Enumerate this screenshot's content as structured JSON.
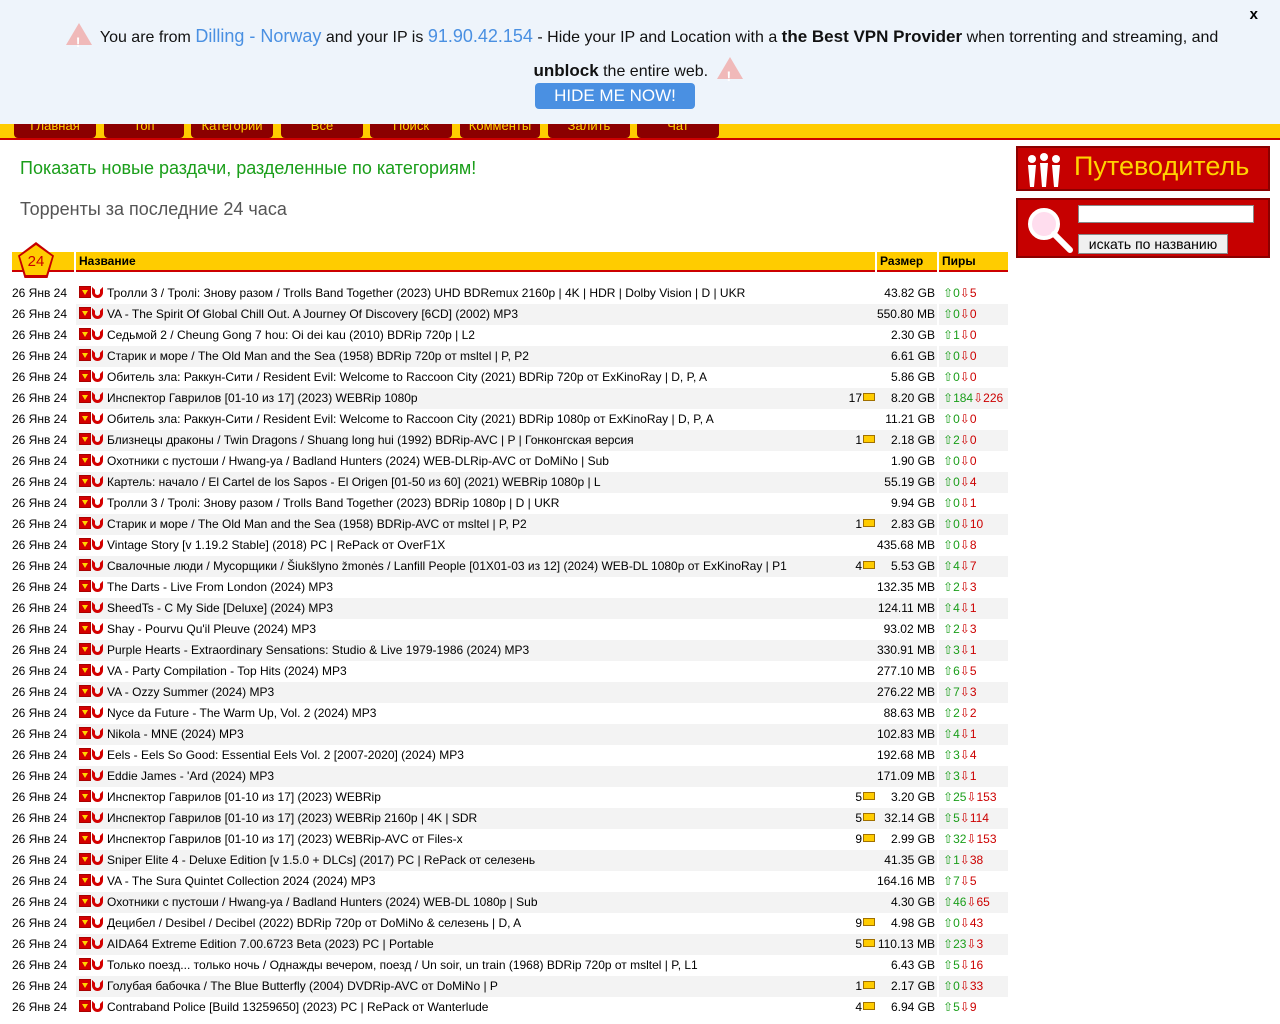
{
  "banner": {
    "close": "x",
    "t1": "You are from",
    "location": "Dilling - Norway",
    "t2": "and your IP is",
    "ip": "91.90.42.154",
    "t3": "- Hide your IP and Location with a",
    "best_vpn": "the Best VPN Provider",
    "t4": "when torrenting and streaming, and",
    "unblock": "unblock",
    "t5": "the entire web.",
    "button": "HIDE ME NOW!"
  },
  "nav": [
    "Главная",
    "Топ",
    "Категории",
    "Все",
    "Поиск",
    "Комменты",
    "Залить",
    "Чат"
  ],
  "promo": "Показать новые раздачи, разделенные по категориям!",
  "heading": "Торренты за последние 24 часа",
  "table": {
    "badge": "24",
    "col_name": "Название",
    "col_size": "Размер",
    "col_peers": "Пиры",
    "rows": [
      {
        "date": "26 Янв 24",
        "title": "Тролли 3 / Тролі: Знову разом / Trolls Band Together (2023) UHD BDRemux 2160p | 4K | HDR | Dolby Vision | D | UKR",
        "comments": "",
        "size": "43.82 GB",
        "seeds": "0",
        "leech": "5"
      },
      {
        "date": "26 Янв 24",
        "title": "VA - The Spirit Of Global Chill Out. A Journey Of Discovery [6CD] (2002) MP3",
        "comments": "",
        "size": "550.80 MB",
        "seeds": "0",
        "leech": "0"
      },
      {
        "date": "26 Янв 24",
        "title": "Седьмой 2 / Cheung Gong 7 hou: Oi dei kau (2010) BDRip 720p | L2",
        "comments": "",
        "size": "2.30 GB",
        "seeds": "1",
        "leech": "0"
      },
      {
        "date": "26 Янв 24",
        "title": "Старик и море / The Old Man and the Sea (1958) BDRip 720p от msltel | P, P2",
        "comments": "",
        "size": "6.61 GB",
        "seeds": "0",
        "leech": "0"
      },
      {
        "date": "26 Янв 24",
        "title": "Обитель зла: Раккун-Сити / Resident Evil: Welcome to Raccoon City (2021) BDRip 720p от ExKinoRay | D, P, A",
        "comments": "",
        "size": "5.86 GB",
        "seeds": "0",
        "leech": "0"
      },
      {
        "date": "26 Янв 24",
        "title": "Инспектор Гаврилов [01-10 из 17] (2023) WEBRip 1080p",
        "comments": "17",
        "size": "8.20 GB",
        "seeds": "184",
        "leech": "226"
      },
      {
        "date": "26 Янв 24",
        "title": "Обитель зла: Раккун-Сити / Resident Evil: Welcome to Raccoon City (2021) BDRip 1080p от ExKinoRay | D, P, A",
        "comments": "",
        "size": "11.21 GB",
        "seeds": "0",
        "leech": "0"
      },
      {
        "date": "26 Янв 24",
        "title": "Близнецы драконы / Twin Dragons / Shuang long hui (1992) BDRip-AVC | P | Гонконгская версия",
        "comments": "1",
        "size": "2.18 GB",
        "seeds": "2",
        "leech": "0"
      },
      {
        "date": "26 Янв 24",
        "title": "Охотники с пустоши / Hwang-ya / Badland Hunters (2024) WEB-DLRip-AVC от DoMiNo | Sub",
        "comments": "",
        "size": "1.90 GB",
        "seeds": "0",
        "leech": "0"
      },
      {
        "date": "26 Янв 24",
        "title": "Картель: начало / El Cartel de los Sapos - El Origen [01-50 из 60] (2021) WEBRip 1080p | L",
        "comments": "",
        "size": "55.19 GB",
        "seeds": "0",
        "leech": "4"
      },
      {
        "date": "26 Янв 24",
        "title": "Тролли 3 / Тролі: Знову разом / Trolls Band Together (2023) BDRip 1080p | D | UKR",
        "comments": "",
        "size": "9.94 GB",
        "seeds": "0",
        "leech": "1"
      },
      {
        "date": "26 Янв 24",
        "title": "Старик и море / The Old Man and the Sea (1958) BDRip-AVC от msltel | P, P2",
        "comments": "1",
        "size": "2.83 GB",
        "seeds": "0",
        "leech": "10"
      },
      {
        "date": "26 Янв 24",
        "title": "Vintage Story [v 1.19.2 Stable] (2018) PC | RePack от OverF1X",
        "comments": "",
        "size": "435.68 MB",
        "seeds": "0",
        "leech": "8"
      },
      {
        "date": "26 Янв 24",
        "title": "Свалочные люди / Мусорщики / Šiukšlyno žmonės / Lanfill People [01X01-03 из 12] (2024) WEB-DL 1080p от ExKinoRay | P1",
        "comments": "4",
        "size": "5.53 GB",
        "seeds": "4",
        "leech": "7"
      },
      {
        "date": "26 Янв 24",
        "title": "The Darts - Live From London (2024) MP3",
        "comments": "",
        "size": "132.35 MB",
        "seeds": "2",
        "leech": "3"
      },
      {
        "date": "26 Янв 24",
        "title": "SheedTs - C My Side [Deluxe] (2024) MP3",
        "comments": "",
        "size": "124.11 MB",
        "seeds": "4",
        "leech": "1"
      },
      {
        "date": "26 Янв 24",
        "title": "Shay - Pourvu Qu'il Pleuve (2024) MP3",
        "comments": "",
        "size": "93.02 MB",
        "seeds": "2",
        "leech": "3"
      },
      {
        "date": "26 Янв 24",
        "title": "Purple Hearts - Extraordinary Sensations: Studio & Live 1979-1986 (2024) MP3",
        "comments": "",
        "size": "330.91 MB",
        "seeds": "3",
        "leech": "1"
      },
      {
        "date": "26 Янв 24",
        "title": "VA - Party Compilation - Top Hits (2024) MP3",
        "comments": "",
        "size": "277.10 MB",
        "seeds": "6",
        "leech": "5"
      },
      {
        "date": "26 Янв 24",
        "title": "VA - Ozzy Summer (2024) MP3",
        "comments": "",
        "size": "276.22 MB",
        "seeds": "7",
        "leech": "3"
      },
      {
        "date": "26 Янв 24",
        "title": "Nyce da Future - The Warm Up, Vol. 2 (2024) MP3",
        "comments": "",
        "size": "88.63 MB",
        "seeds": "2",
        "leech": "2"
      },
      {
        "date": "26 Янв 24",
        "title": "Nikola - MNE (2024) MP3",
        "comments": "",
        "size": "102.83 MB",
        "seeds": "4",
        "leech": "1"
      },
      {
        "date": "26 Янв 24",
        "title": "Eels - Eels So Good: Essential Eels Vol. 2 [2007-2020] (2024) MP3",
        "comments": "",
        "size": "192.68 MB",
        "seeds": "3",
        "leech": "4"
      },
      {
        "date": "26 Янв 24",
        "title": "Eddie James - 'Ard (2024) MP3",
        "comments": "",
        "size": "171.09 MB",
        "seeds": "3",
        "leech": "1"
      },
      {
        "date": "26 Янв 24",
        "title": "Инспектор Гаврилов [01-10 из 17] (2023) WEBRip",
        "comments": "5",
        "size": "3.20 GB",
        "seeds": "25",
        "leech": "153"
      },
      {
        "date": "26 Янв 24",
        "title": "Инспектор Гаврилов [01-10 из 17] (2023) WEBRip 2160p | 4K | SDR",
        "comments": "5",
        "size": "32.14 GB",
        "seeds": "5",
        "leech": "114"
      },
      {
        "date": "26 Янв 24",
        "title": "Инспектор Гаврилов [01-10 из 17] (2023) WEBRip-AVC от Files-x",
        "comments": "9",
        "size": "2.99 GB",
        "seeds": "32",
        "leech": "153"
      },
      {
        "date": "26 Янв 24",
        "title": "Sniper Elite 4 - Deluxe Edition [v 1.5.0 + DLCs] (2017) PC | RePack от селезень",
        "comments": "",
        "size": "41.35 GB",
        "seeds": "1",
        "leech": "38"
      },
      {
        "date": "26 Янв 24",
        "title": "VA - The Sura Quintet Collection 2024 (2024) MP3",
        "comments": "",
        "size": "164.16 MB",
        "seeds": "7",
        "leech": "5"
      },
      {
        "date": "26 Янв 24",
        "title": "Охотники с пустоши / Hwang-ya / Badland Hunters (2024) WEB-DL 1080p | Sub",
        "comments": "",
        "size": "4.30 GB",
        "seeds": "46",
        "leech": "65"
      },
      {
        "date": "26 Янв 24",
        "title": "Децибел / Desibel / Decibel (2022) BDRip 720p от DoMiNo & селезень | D, A",
        "comments": "9",
        "size": "4.98 GB",
        "seeds": "0",
        "leech": "43"
      },
      {
        "date": "26 Янв 24",
        "title": "AIDA64 Extreme Edition 7.00.6723 Beta (2023) PC | Portable",
        "comments": "5",
        "size": "110.13 MB",
        "seeds": "23",
        "leech": "3"
      },
      {
        "date": "26 Янв 24",
        "title": "Только поезд... только ночь / Однажды вечером, поезд / Un soir, un train (1968) BDRip 720p от msltel | P, L1",
        "comments": "",
        "size": "6.43 GB",
        "seeds": "5",
        "leech": "16"
      },
      {
        "date": "26 Янв 24",
        "title": "Голубая бабочка / The Blue Butterfly (2004) DVDRip-AVC от DoMiNo | P",
        "comments": "1",
        "size": "2.17 GB",
        "seeds": "0",
        "leech": "33"
      },
      {
        "date": "26 Янв 24",
        "title": "Contraband Police [Build 13259650] (2023) PC | RePack от Wanterlude",
        "comments": "4",
        "size": "6.94 GB",
        "seeds": "5",
        "leech": "9"
      }
    ]
  },
  "sidebar": {
    "guide": "Путеводитель",
    "search_placeholder": "",
    "search_button": "искать по названию"
  },
  "colors": {
    "accent_yellow": "#ffcc00",
    "accent_red": "#c60000",
    "seed_green": "#1a9e1a",
    "leech_red": "#cc0000",
    "link_blue": "#4a90e2"
  }
}
